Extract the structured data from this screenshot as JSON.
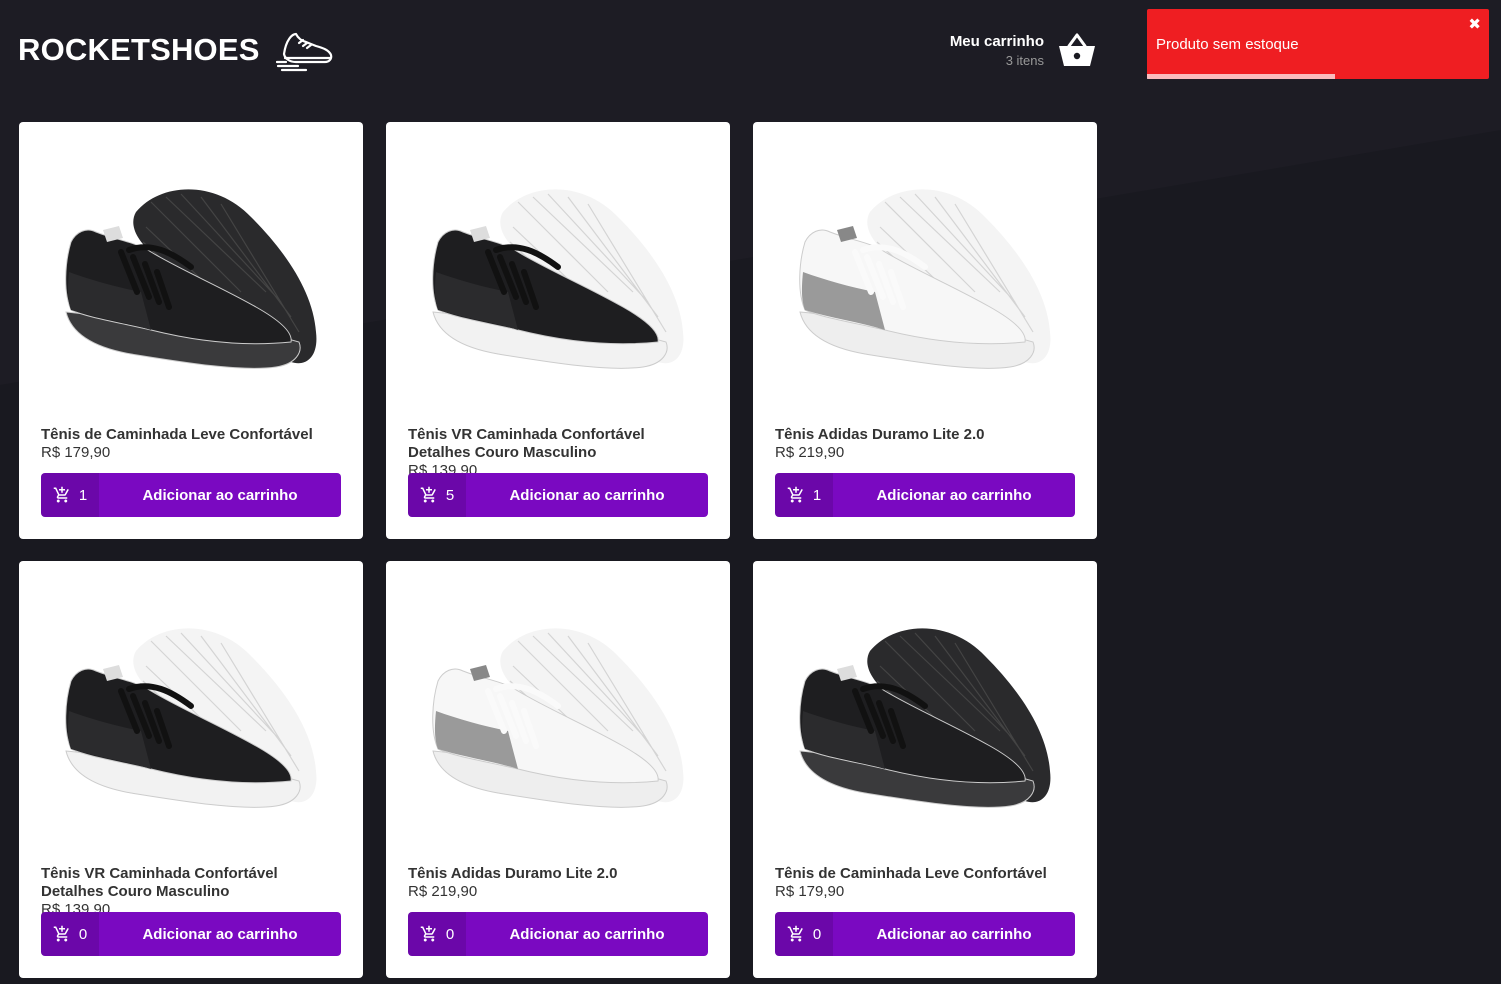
{
  "header": {
    "logo_text": "ROCKETSHOES",
    "logo_icon": "sneaker-icon",
    "cart_title": "Meu carrinho",
    "cart_count": "3 itens",
    "cart_icon": "basket-icon"
  },
  "toast": {
    "message": "Produto sem estoque",
    "close_glyph": "✖",
    "progress": 0.55,
    "color": "#ef1e22"
  },
  "colors": {
    "background": "#191920",
    "button": "#7a09c1",
    "card": "#ffffff"
  },
  "products": [
    {
      "title": "Tênis de Caminhada Leve Confortável",
      "price": "R$ 179,90",
      "amount": "1",
      "button": "Adicionar ao carrinho",
      "shoe": "black-black"
    },
    {
      "title": "Tênis VR Caminhada Confortável Detalhes Couro Masculino",
      "price": "R$ 139,90",
      "amount": "5",
      "button": "Adicionar ao carrinho",
      "shoe": "black-white"
    },
    {
      "title": "Tênis Adidas Duramo Lite 2.0",
      "price": "R$ 219,90",
      "amount": "1",
      "button": "Adicionar ao carrinho",
      "shoe": "white-grey"
    },
    {
      "title": "Tênis VR Caminhada Confortável Detalhes Couro Masculino",
      "price": "R$ 139,90",
      "amount": "0",
      "button": "Adicionar ao carrinho",
      "shoe": "black-white"
    },
    {
      "title": "Tênis Adidas Duramo Lite 2.0",
      "price": "R$ 219,90",
      "amount": "0",
      "button": "Adicionar ao carrinho",
      "shoe": "white-grey"
    },
    {
      "title": "Tênis de Caminhada Leve Confortável",
      "price": "R$ 179,90",
      "amount": "0",
      "button": "Adicionar ao carrinho",
      "shoe": "black-black"
    }
  ]
}
